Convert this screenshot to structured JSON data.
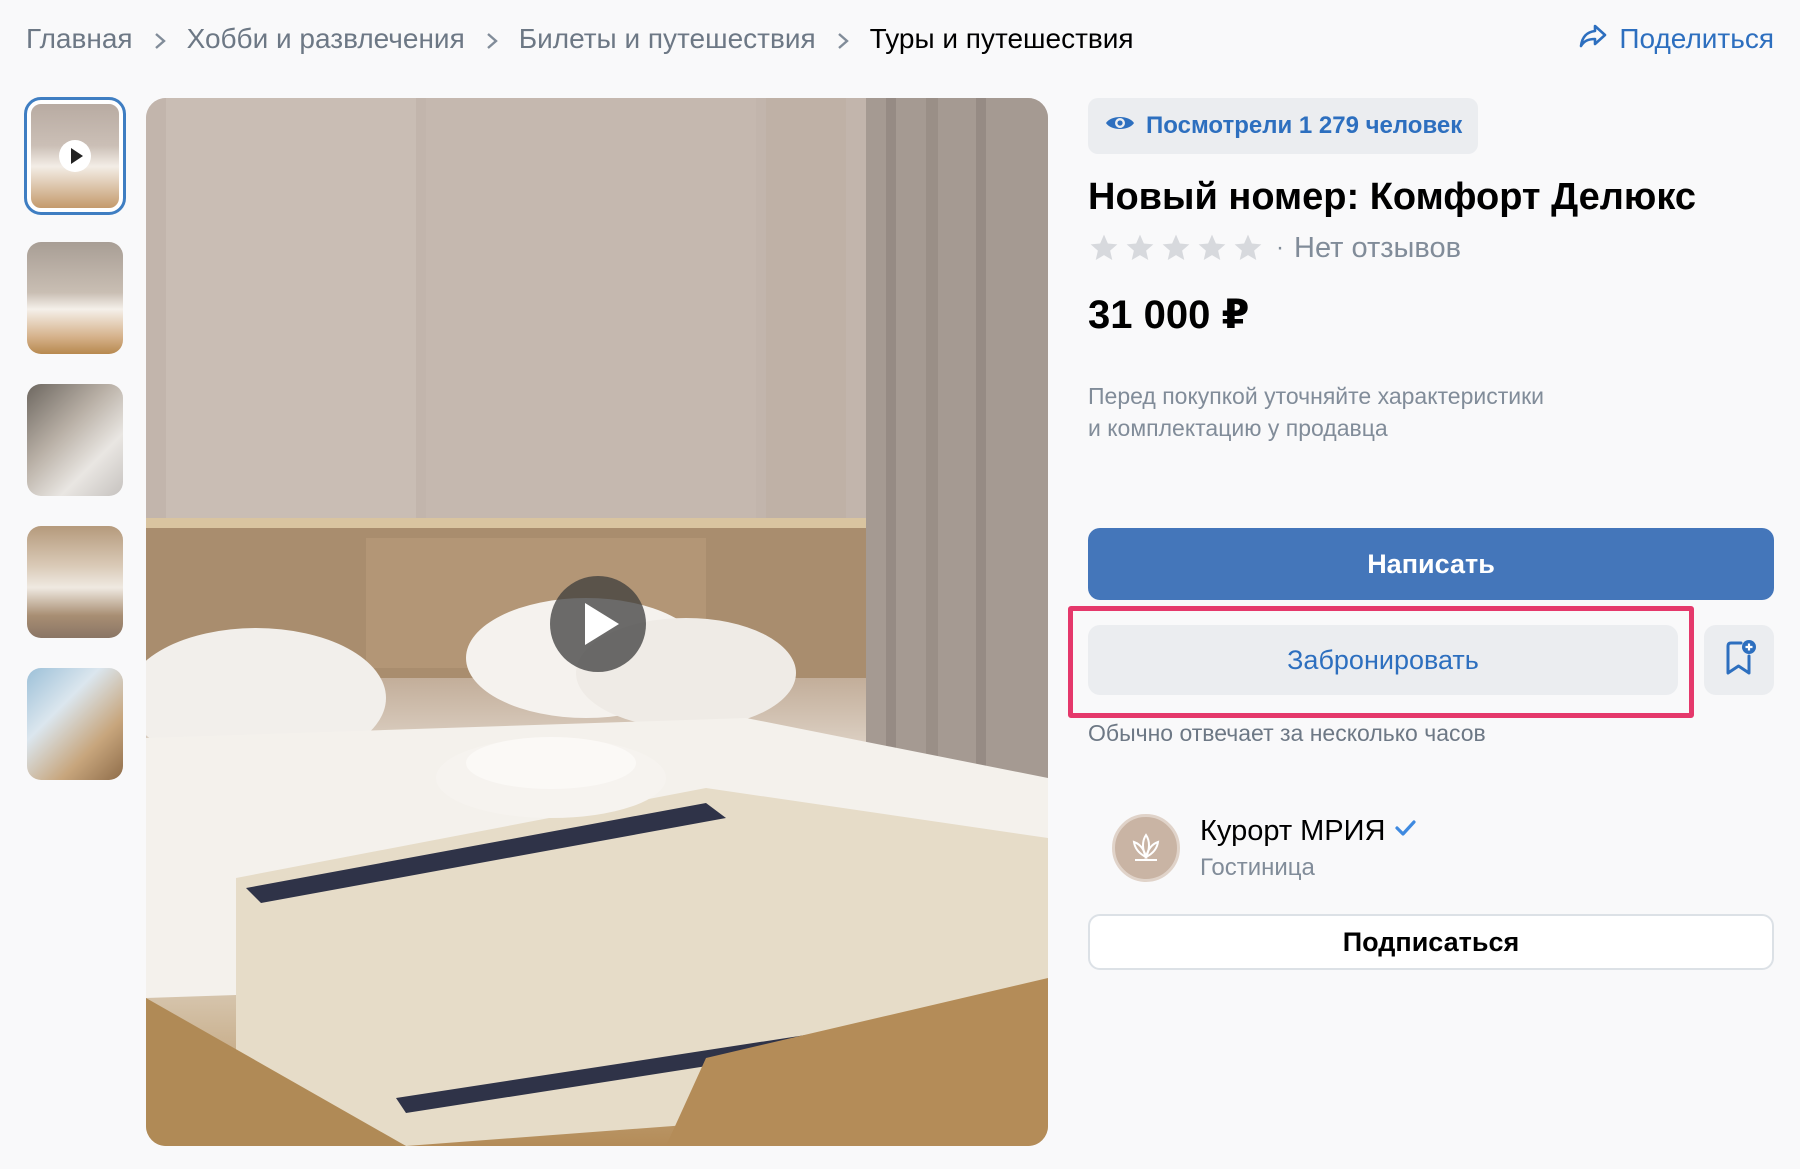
{
  "breadcrumb": {
    "items": [
      "Главная",
      "Хобби и развлечения",
      "Билеты и путешествия",
      "Туры и путешествия"
    ]
  },
  "share": {
    "label": "Поделиться",
    "icon": "share-arrow-icon"
  },
  "gallery": {
    "thumbnails": [
      "video-thumb",
      "photo-2",
      "photo-3",
      "photo-4",
      "photo-5"
    ],
    "active_index": 0
  },
  "product": {
    "views": "Посмотрели 1 279 человек",
    "title": "Новый номер: Комфорт Делюкс",
    "rating_stars": 0,
    "rating_max": 5,
    "reviews": "Нет отзывов",
    "price": "31 000 ₽",
    "note_line1": "Перед покупкой уточняйте характеристики",
    "note_line2": "и комплектацию у продавца"
  },
  "actions": {
    "write": "Написать",
    "book": "Забронировать",
    "reply_time": "Обычно отвечает за несколько часов"
  },
  "seller": {
    "name": "Курорт МРИЯ",
    "type": "Гостиница",
    "subscribe": "Подписаться",
    "verified": true
  },
  "colors": {
    "accent": "#4476ba",
    "link": "#2d6fbf",
    "highlight": "#e5386b"
  }
}
